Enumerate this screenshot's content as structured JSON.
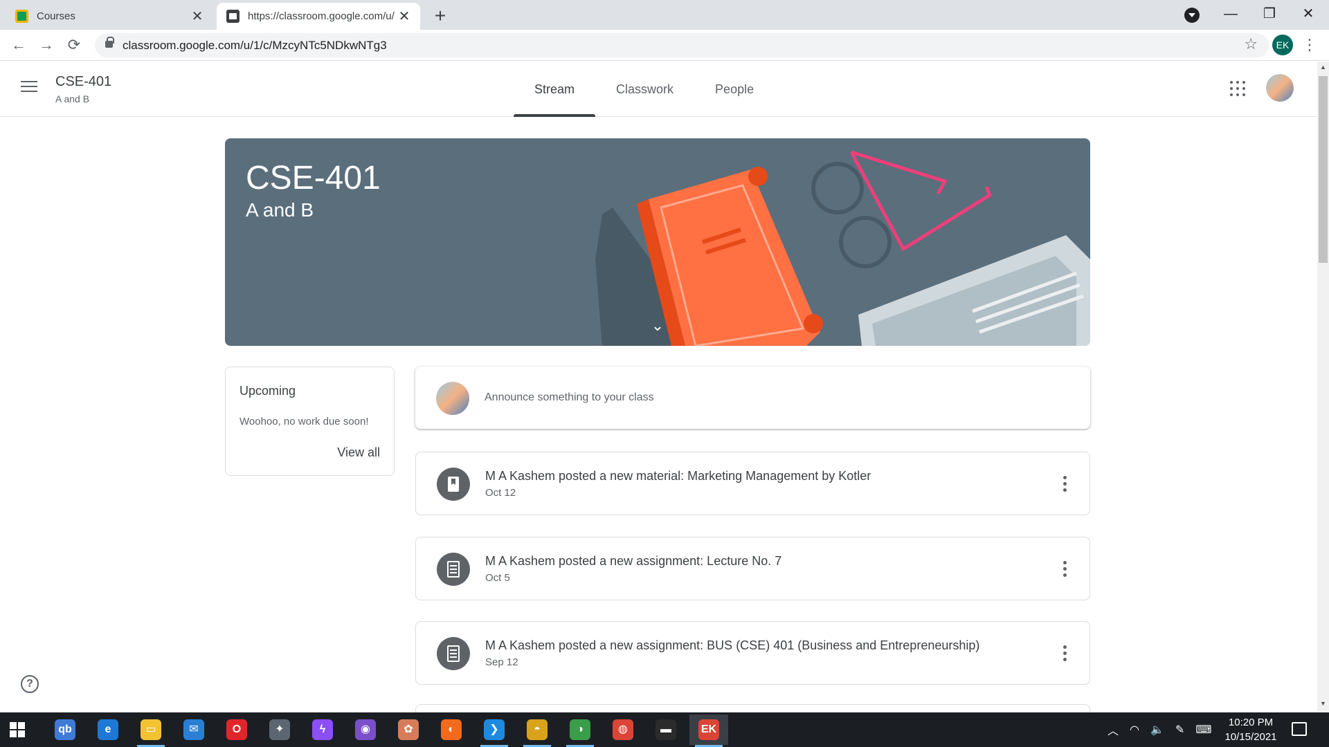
{
  "browser": {
    "tabs": [
      {
        "title": "Courses",
        "active": false
      },
      {
        "title": "https://classroom.google.com/u/",
        "active": true
      }
    ],
    "new_tab_label": "+",
    "tab_close_glyph": "✕",
    "url": "classroom.google.com/u/1/c/MzcyNTc5NDkwNTg3",
    "profile_initials": "EK",
    "back_glyph": "←",
    "forward_glyph": "→",
    "reload_glyph": "⟳",
    "star_glyph": "☆",
    "menu_glyph": "⋮",
    "window_controls": {
      "minimize": "—",
      "maximize": "❐",
      "close": "✕"
    }
  },
  "header": {
    "course_name": "CSE-401",
    "section": "A and B",
    "tabs": [
      {
        "label": "Stream",
        "active": true
      },
      {
        "label": "Classwork",
        "active": false
      },
      {
        "label": "People",
        "active": false
      }
    ]
  },
  "banner": {
    "title": "CSE-401",
    "subtitle": "A and B",
    "background_color": "#5a6e7c",
    "chevron_glyph": "⌄"
  },
  "upcoming": {
    "title": "Upcoming",
    "message": "Woohoo, no work due soon!",
    "view_all_label": "View all"
  },
  "announce": {
    "placeholder": "Announce something to your class"
  },
  "stream": {
    "posts": [
      {
        "type": "material",
        "icon": "book-icon",
        "title": "M A Kashem posted a new material: Marketing Management by Kotler",
        "date": "Oct 12"
      },
      {
        "type": "assignment",
        "icon": "assignment-icon",
        "title": "M A Kashem posted a new assignment: Lecture No. 7",
        "date": "Oct 5"
      },
      {
        "type": "assignment",
        "icon": "assignment-icon",
        "title": "M A Kashem posted a new assignment: BUS (CSE) 401 (Business and Entrepreneurship)",
        "date": "Sep 12"
      }
    ]
  },
  "help_glyph": "?",
  "taskbar": {
    "apps": [
      {
        "name": "qbittorrent-icon",
        "glyph": "qb",
        "color": "#3f7bd6"
      },
      {
        "name": "edge-icon",
        "glyph": "e",
        "color": "#1e78d6"
      },
      {
        "name": "file-explorer-icon",
        "glyph": "▭",
        "color": "#f2c230"
      },
      {
        "name": "mail-icon",
        "glyph": "✉",
        "color": "#2a7fd4"
      },
      {
        "name": "opera-icon",
        "glyph": "O",
        "color": "#e0262b"
      },
      {
        "name": "satellite-app-icon",
        "glyph": "✦",
        "color": "#5c6670"
      },
      {
        "name": "messenger-icon",
        "glyph": "ϟ",
        "color": "#8a4ff5"
      },
      {
        "name": "github-desktop-icon",
        "glyph": "◉",
        "color": "#7b4fc9"
      },
      {
        "name": "paint-app-icon",
        "glyph": "✿",
        "color": "#d67c5a"
      },
      {
        "name": "firefox-icon",
        "glyph": "◐",
        "color": "#f26b1d"
      },
      {
        "name": "vscode-icon",
        "glyph": "❯",
        "color": "#1d8ae0"
      },
      {
        "name": "chrome-canary-icon",
        "glyph": "◓",
        "color": "#d8a21b"
      },
      {
        "name": "chrome-profile-icon",
        "glyph": "◑",
        "color": "#3a9d4a"
      },
      {
        "name": "chrome-icon",
        "glyph": "◍",
        "color": "#db4437"
      },
      {
        "name": "terminal-icon",
        "glyph": "▬",
        "color": "#2b2b2b"
      },
      {
        "name": "chrome-ek-icon",
        "glyph": "EK",
        "color": "#db4437"
      }
    ],
    "clock_time": "10:20 PM",
    "clock_date": "10/15/2021",
    "tray_icons": {
      "chevron": "︿",
      "network": "◠",
      "volume": "🔈",
      "pen": "✎",
      "keyboard": "⌨"
    }
  }
}
